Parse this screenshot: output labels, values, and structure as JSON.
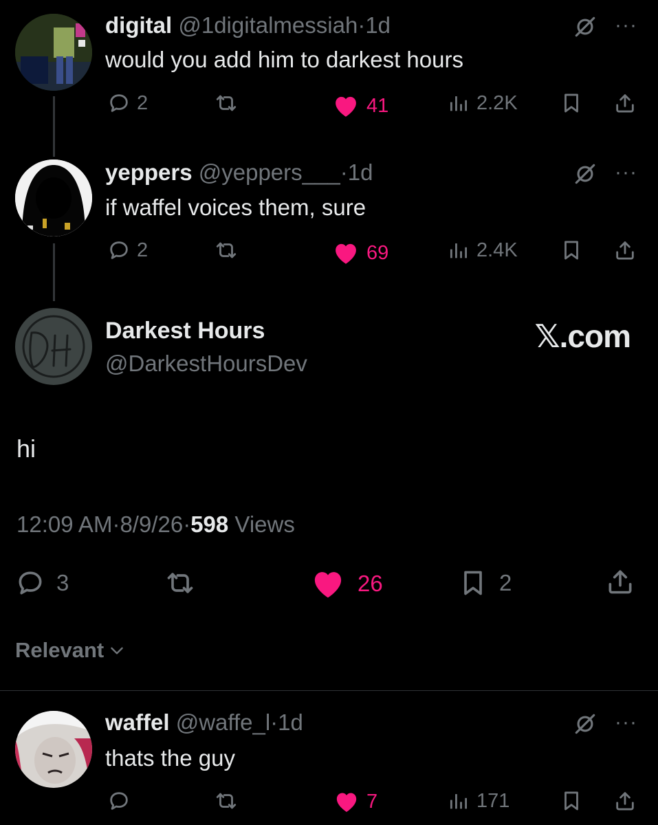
{
  "tweets": [
    {
      "name": "digital",
      "handle": "@1digitalmessiah",
      "dot": "·",
      "time": "1d",
      "text": "would you add him to darkest hours",
      "replies": "2",
      "retweets": "",
      "likes": "41",
      "views": "2.2K"
    },
    {
      "name": "yeppers",
      "handle": "@yeppers___",
      "dot": "·",
      "time": "1d",
      "text": "if waffel voices them, sure",
      "replies": "2",
      "retweets": "",
      "likes": "69",
      "views": "2.4K"
    }
  ],
  "main": {
    "name": "Darkest Hours",
    "handle": "@DarkestHoursDev",
    "brand": "𝕏.com",
    "text": "hi",
    "time": "12:09 AM",
    "dot": "·",
    "date": "8/9/26",
    "views_count": "598",
    "views_label": "Views",
    "replies": "3",
    "likes": "26",
    "bookmarks": "2"
  },
  "sort": {
    "label": "Relevant"
  },
  "reply": {
    "name": "waffel",
    "handle": "@waffe_l",
    "dot": "·",
    "time": "1d",
    "text": "thats the guy",
    "replies": "",
    "likes": "7",
    "views": "171"
  },
  "icons": {
    "reply": "reply-icon",
    "retweet": "retweet-icon",
    "like": "heart-icon",
    "views": "views-icon",
    "bookmark": "bookmark-icon",
    "share": "share-icon",
    "grok": "grok-icon",
    "more": "more-icon"
  },
  "colors": {
    "background": "#000000",
    "text": "#e7e9ea",
    "secondary": "#71767b",
    "like": "#f91880"
  }
}
